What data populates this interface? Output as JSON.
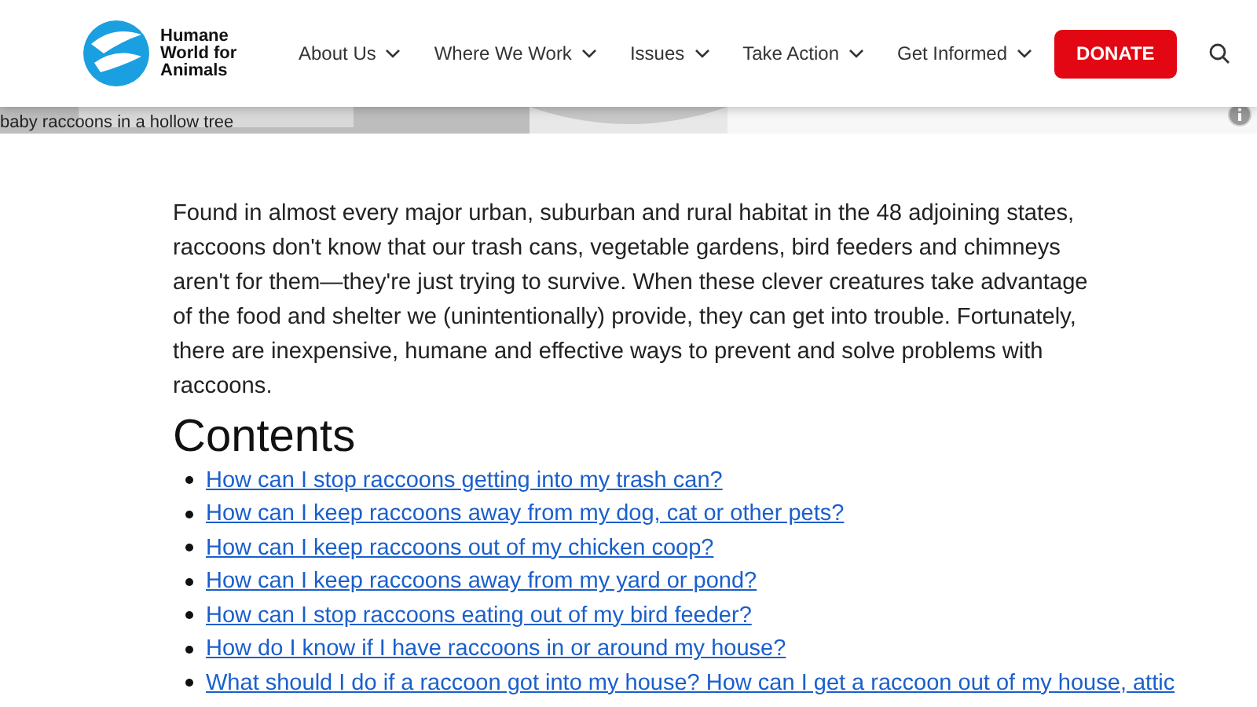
{
  "header": {
    "logo_text": "Humane World for Animals",
    "nav": [
      "About Us",
      "Where We Work",
      "Issues",
      "Take Action",
      "Get Informed"
    ],
    "donate": "DONATE"
  },
  "hero": {
    "kind": "picture",
    "caption": "baby raccoons in a hollow tree"
  },
  "intro": "Found in almost every major urban, suburban and rural habitat in the 48 adjoining states, raccoons don't know that our trash cans, vegetable gardens, bird feeders and chimneys aren't for them—they're just trying to survive. When these clever creatures take advantage of the food and shelter we (unintentionally) provide, they can get into trouble. Fortunately, there are inexpensive, humane and effective ways to prevent and solve problems with raccoons.",
  "contents": {
    "heading": "Contents",
    "links": [
      "How can I stop raccoons getting into my trash can?",
      "How can I keep raccoons away from my dog, cat or other pets?",
      "How can I keep raccoons out of my chicken coop?",
      "How can I keep raccoons away from my yard or pond?",
      "How can I stop raccoons eating out of my bird feeder?",
      "How do I know if I have raccoons in or around my house?",
      "What should I do if a raccoon got into my house? How can I get a raccoon out of my house, attic"
    ]
  }
}
